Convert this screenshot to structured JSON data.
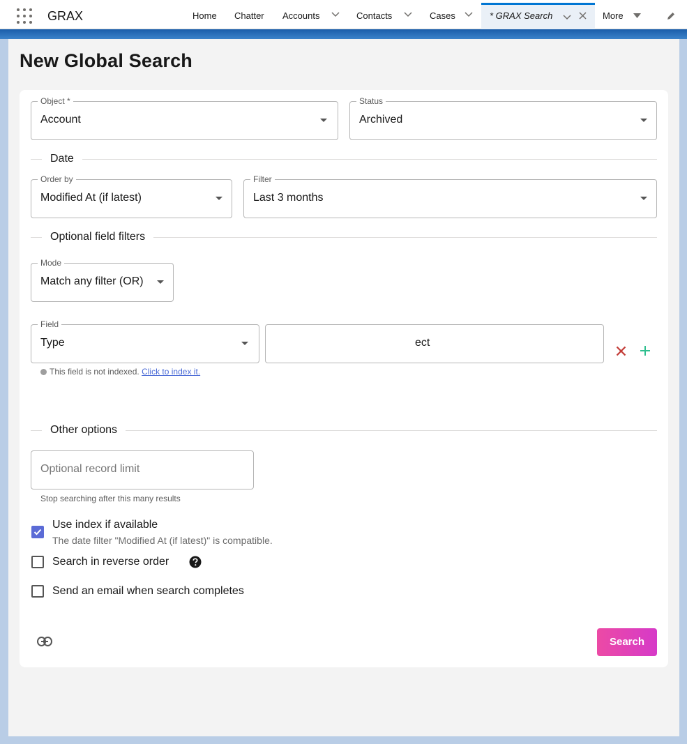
{
  "app": {
    "name": "GRAX"
  },
  "nav": {
    "items": [
      {
        "label": "Home",
        "has_menu": false
      },
      {
        "label": "Chatter",
        "has_menu": false
      },
      {
        "label": "Accounts",
        "has_menu": true
      },
      {
        "label": "Contacts",
        "has_menu": true
      },
      {
        "label": "Cases",
        "has_menu": true
      }
    ],
    "active_tab": "* GRAX Search",
    "more": "More"
  },
  "page": {
    "title": "New Global Search"
  },
  "form": {
    "object": {
      "label": "Object *",
      "value": "Account"
    },
    "status": {
      "label": "Status",
      "value": "Archived"
    },
    "date_section": "Date",
    "order_by": {
      "label": "Order by",
      "value": "Modified At (if latest)"
    },
    "filter": {
      "label": "Filter",
      "value": "Last 3 months"
    },
    "optional_section": "Optional field filters",
    "mode": {
      "label": "Mode",
      "value": "Match any filter (OR)"
    },
    "field": {
      "label": "Field",
      "value": "Type"
    },
    "field_value": {
      "value": "ect"
    },
    "index_note": "This field is not indexed.",
    "index_link": "Click to index it.",
    "other_section": "Other options",
    "record_limit": {
      "placeholder": "Optional record limit",
      "helper": "Stop searching after this many results"
    },
    "use_index": {
      "label": "Use index if available",
      "checked": true,
      "helper": "The date filter \"Modified At (if latest)\" is compatible."
    },
    "reverse_order": {
      "label": "Search in reverse order",
      "checked": false
    },
    "send_email": {
      "label": "Send an email when search completes",
      "checked": false
    },
    "search_button": "Search"
  },
  "colors": {
    "accent": "#5b6bd6",
    "remove": "#c23934",
    "add": "#2fbf8f",
    "brand_blue": "#0176d3"
  }
}
